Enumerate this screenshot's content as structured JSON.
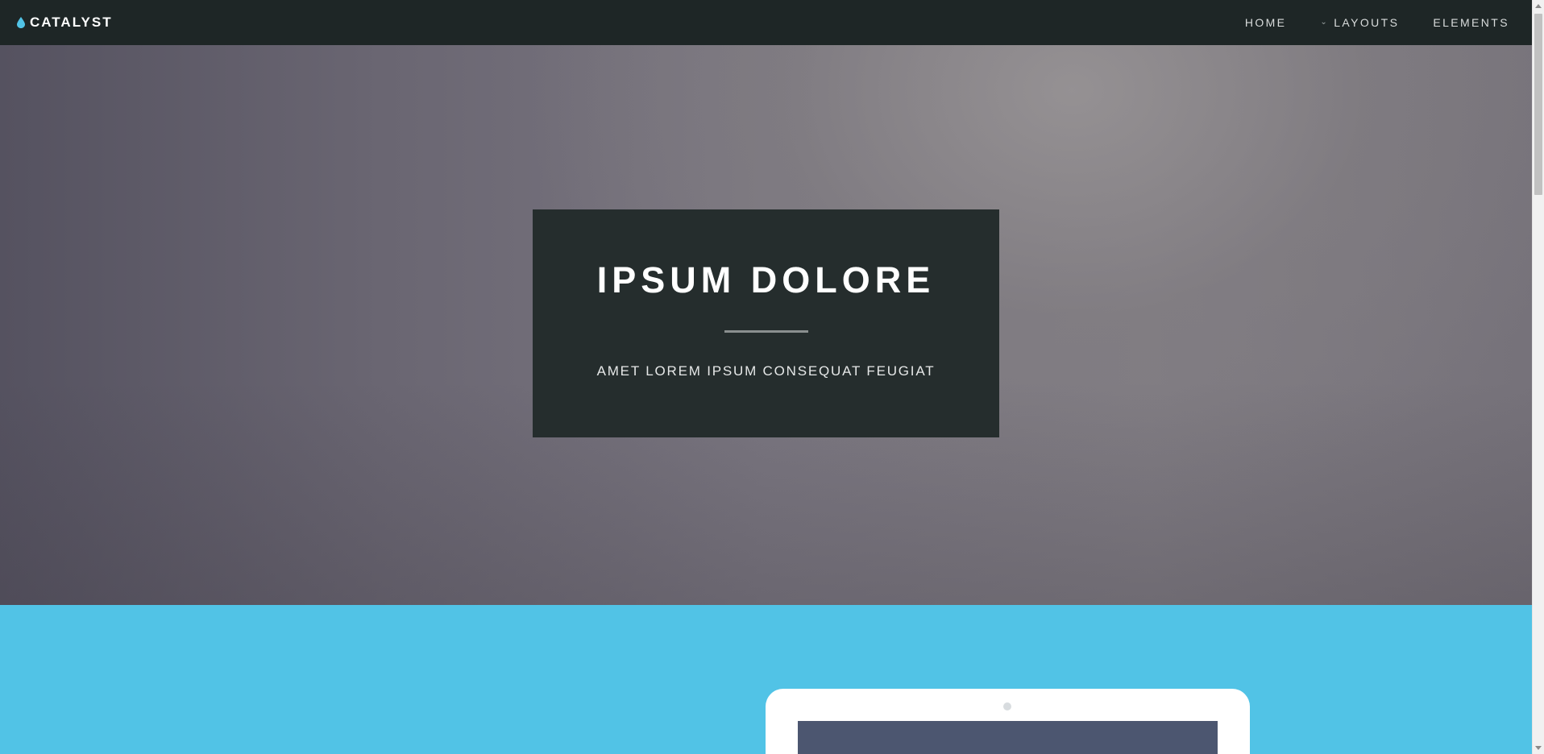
{
  "navbar": {
    "brand": "CATALYST",
    "brand_icon": "drop-icon",
    "items": [
      {
        "label": "HOME"
      },
      {
        "label": "LAYOUTS",
        "icon": "chevron-down-icon"
      },
      {
        "label": "ELEMENTS"
      }
    ]
  },
  "hero": {
    "title": "IPSUM DOLORE",
    "subtitle": "AMET LOREM IPSUM CONSEQUAT FEUGIAT"
  },
  "colors": {
    "navbar_bg": "#1e2626",
    "brand_accent": "#51c3e6",
    "hero_box_bg": "#252d2d",
    "feature_bg": "#51c3e6",
    "device_screen": "#4c5670"
  }
}
